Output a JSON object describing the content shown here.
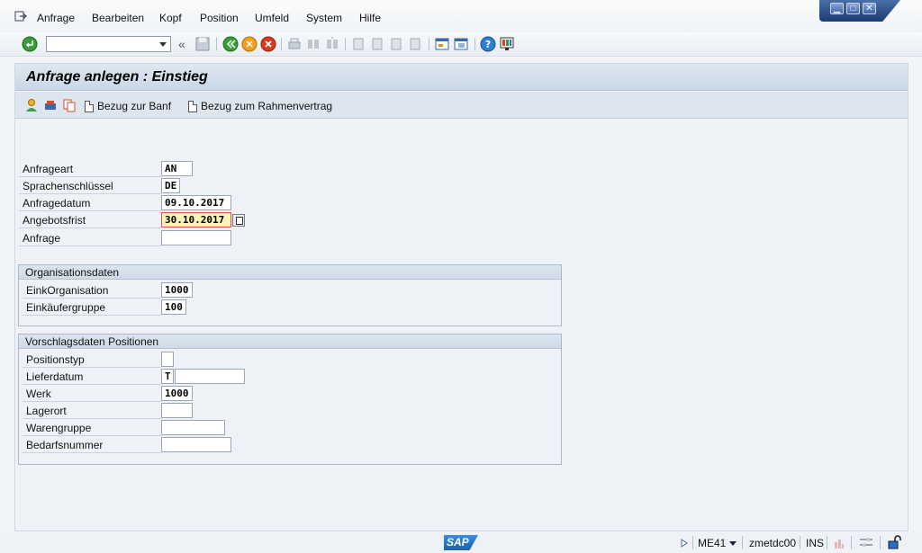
{
  "menu": {
    "items": [
      {
        "label": "Anfrage"
      },
      {
        "label": "Bearbeiten"
      },
      {
        "label": "Kopf"
      },
      {
        "label": "Position"
      },
      {
        "label": "Umfeld"
      },
      {
        "label": "System"
      },
      {
        "label": "Hilfe"
      }
    ]
  },
  "window_controls": {
    "minimize": "▁",
    "maximize": "□",
    "close": "✕"
  },
  "toolbar": {
    "command_field_value": "",
    "collapse_label": "«"
  },
  "screen": {
    "title": "Anfrage anlegen : Einstieg"
  },
  "app_toolbar": {
    "btn_banf": "Bezug zur Banf",
    "btn_rahmenvertrag": "Bezug zum Rahmenvertrag"
  },
  "header_fields": [
    {
      "label": "Anfrageart",
      "value": "AN"
    },
    {
      "label": "Sprachenschlüssel",
      "value": "DE"
    },
    {
      "label": "Anfragedatum",
      "value": "09.10.2017"
    },
    {
      "label": "Angebotsfrist",
      "value": "30.10.2017"
    },
    {
      "label": "Anfrage",
      "value": ""
    }
  ],
  "org_group": {
    "title": "Organisationsdaten",
    "fields": [
      {
        "label": "EinkOrganisation",
        "value": "1000"
      },
      {
        "label": "Einkäufergruppe",
        "value": "100"
      }
    ]
  },
  "item_group": {
    "title": "Vorschlagsdaten Positionen",
    "fields": [
      {
        "label": "Positionstyp",
        "value": ""
      },
      {
        "label": "Lieferdatum",
        "value": "T",
        "value2": ""
      },
      {
        "label": "Werk",
        "value": "1000"
      },
      {
        "label": "Lagerort",
        "value": ""
      },
      {
        "label": "Warengruppe",
        "value": ""
      },
      {
        "label": "Bedarfsnummer",
        "value": ""
      }
    ]
  },
  "status": {
    "logo": "SAP",
    "transaction": "ME41",
    "server": "zmetdc00",
    "mode": "INS"
  },
  "colors": {
    "accent": "#1c3b73",
    "highlight_field": "#fdf3b4",
    "error_border": "#d9534f"
  }
}
